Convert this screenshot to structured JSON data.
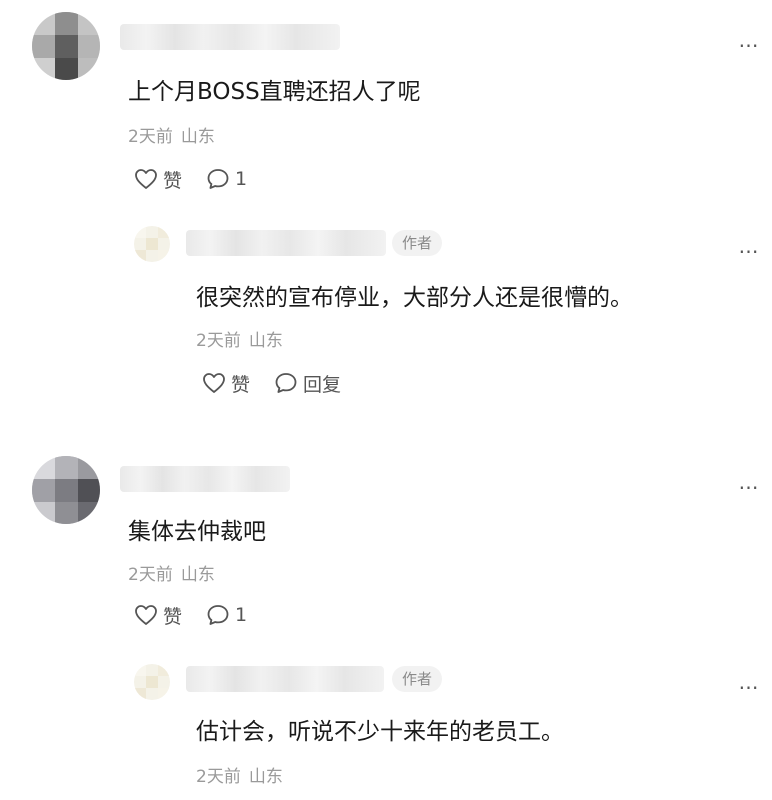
{
  "comments": [
    {
      "content": "上个月BOSS直聘还招人了呢",
      "time": "2天前",
      "location": "山东",
      "like_label": "赞",
      "reply_count": "1",
      "reply": {
        "badge": "作者",
        "content": "很突然的宣布停业，大部分人还是很懵的。",
        "time": "2天前",
        "location": "山东",
        "like_label": "赞",
        "reply_label": "回复"
      }
    },
    {
      "content": "集体去仲裁吧",
      "time": "2天前",
      "location": "山东",
      "like_label": "赞",
      "reply_count": "1",
      "reply": {
        "badge": "作者",
        "content": "估计会，听说不少十来年的老员工。",
        "time": "2天前",
        "location": "山东"
      }
    }
  ],
  "more_icon_glyph": "…",
  "colors": {
    "text_primary": "#1a1a1a",
    "text_meta": "#9a9a9a",
    "badge_bg": "#f2f2f2"
  }
}
